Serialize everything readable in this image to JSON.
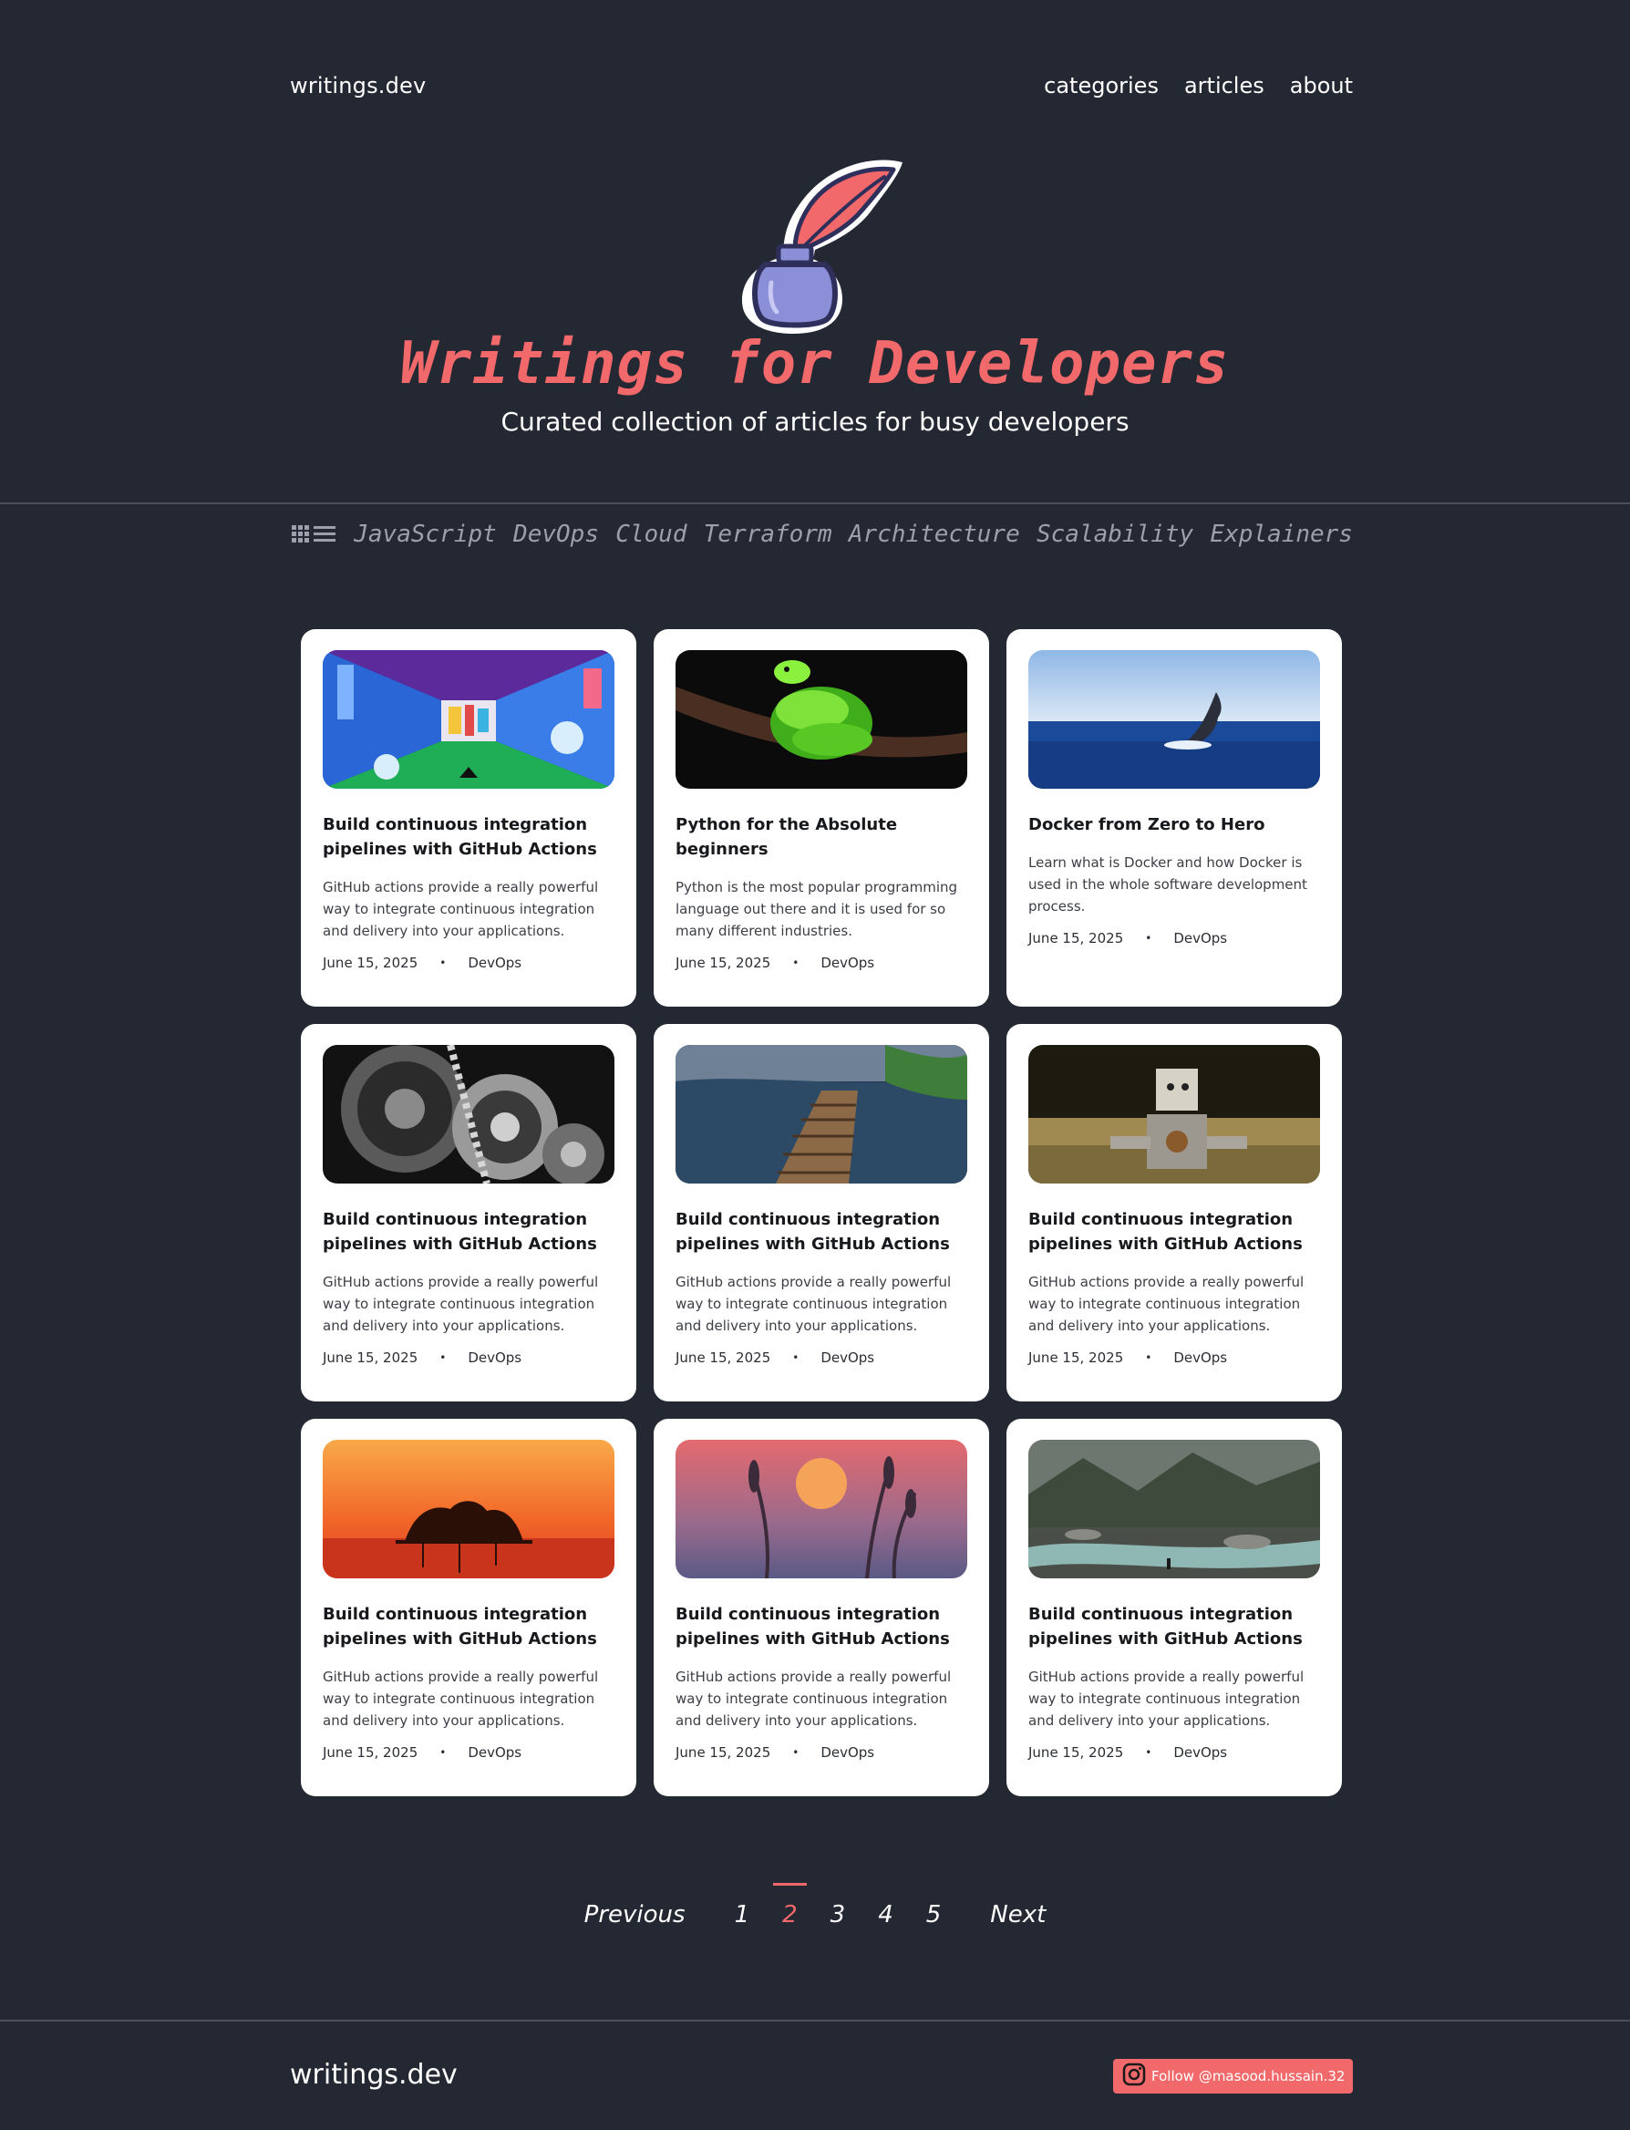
{
  "header": {
    "brand": "writings.dev",
    "nav": [
      "categories",
      "articles",
      "about"
    ]
  },
  "hero": {
    "title": "Writings for Developers",
    "subtitle": "Curated collection of articles for busy developers"
  },
  "categories": [
    "JavaScript",
    "DevOps",
    "Cloud",
    "Terraform",
    "Architecture",
    "Scalability",
    "Explainers"
  ],
  "cards": [
    {
      "image": "colorful-corridor",
      "title": "Build continuous integration pipelines with GitHub Actions",
      "excerpt": "GitHub actions provide a really powerful way to integrate continuous integration and delivery into your applications.",
      "date": "June 15, 2025",
      "category": "DevOps"
    },
    {
      "image": "green-snake",
      "title": "Python for the Absolute beginners",
      "excerpt": "Python is the most popular programming language out there and it is used for so many different industries.",
      "date": "June 15, 2025",
      "category": "DevOps"
    },
    {
      "image": "whale-tail",
      "title": "Docker from Zero to Hero",
      "excerpt": "Learn what is Docker and how Docker is used in the whole software development process.",
      "date": "June 15, 2025",
      "category": "DevOps"
    },
    {
      "image": "gears",
      "title": "Build continuous integration pipelines with GitHub Actions",
      "excerpt": "GitHub actions provide a really powerful way to integrate continuous integration and delivery into your applications.",
      "date": "June 15, 2025",
      "category": "DevOps"
    },
    {
      "image": "wooden-bridge",
      "title": "Build continuous integration pipelines with GitHub Actions",
      "excerpt": "GitHub actions provide a really powerful way to integrate continuous integration and delivery into your applications.",
      "date": "June 15, 2025",
      "category": "DevOps"
    },
    {
      "image": "tin-robot",
      "title": "Build continuous integration pipelines with GitHub Actions",
      "excerpt": "GitHub actions provide a really powerful way to integrate continuous integration and delivery into your applications.",
      "date": "June 15, 2025",
      "category": "DevOps"
    },
    {
      "image": "sunset-island",
      "title": "Build continuous integration pipelines with GitHub Actions",
      "excerpt": "GitHub actions provide a really powerful way to integrate continuous integration and delivery into your applications.",
      "date": "June 15, 2025",
      "category": "DevOps"
    },
    {
      "image": "sunset-grass",
      "title": "Build continuous integration pipelines with GitHub Actions",
      "excerpt": "GitHub actions provide a really powerful way to integrate continuous integration and delivery into your applications.",
      "date": "June 15, 2025",
      "category": "DevOps"
    },
    {
      "image": "mountain-river",
      "title": "Build continuous integration pipelines with GitHub Actions",
      "excerpt": "GitHub actions provide a really powerful way to integrate continuous integration and delivery into your applications.",
      "date": "June 15, 2025",
      "category": "DevOps"
    }
  ],
  "pagination": {
    "previous": "Previous",
    "pages": [
      "1",
      "2",
      "3",
      "4",
      "5"
    ],
    "current": "2",
    "next": "Next"
  },
  "footer": {
    "brand": "writings.dev",
    "follow": "Follow @masood.hussain.32"
  },
  "colors": {
    "background": "#242833",
    "accent": "#f2696b",
    "card": "#ffffff",
    "muted": "#9aa0ac"
  }
}
